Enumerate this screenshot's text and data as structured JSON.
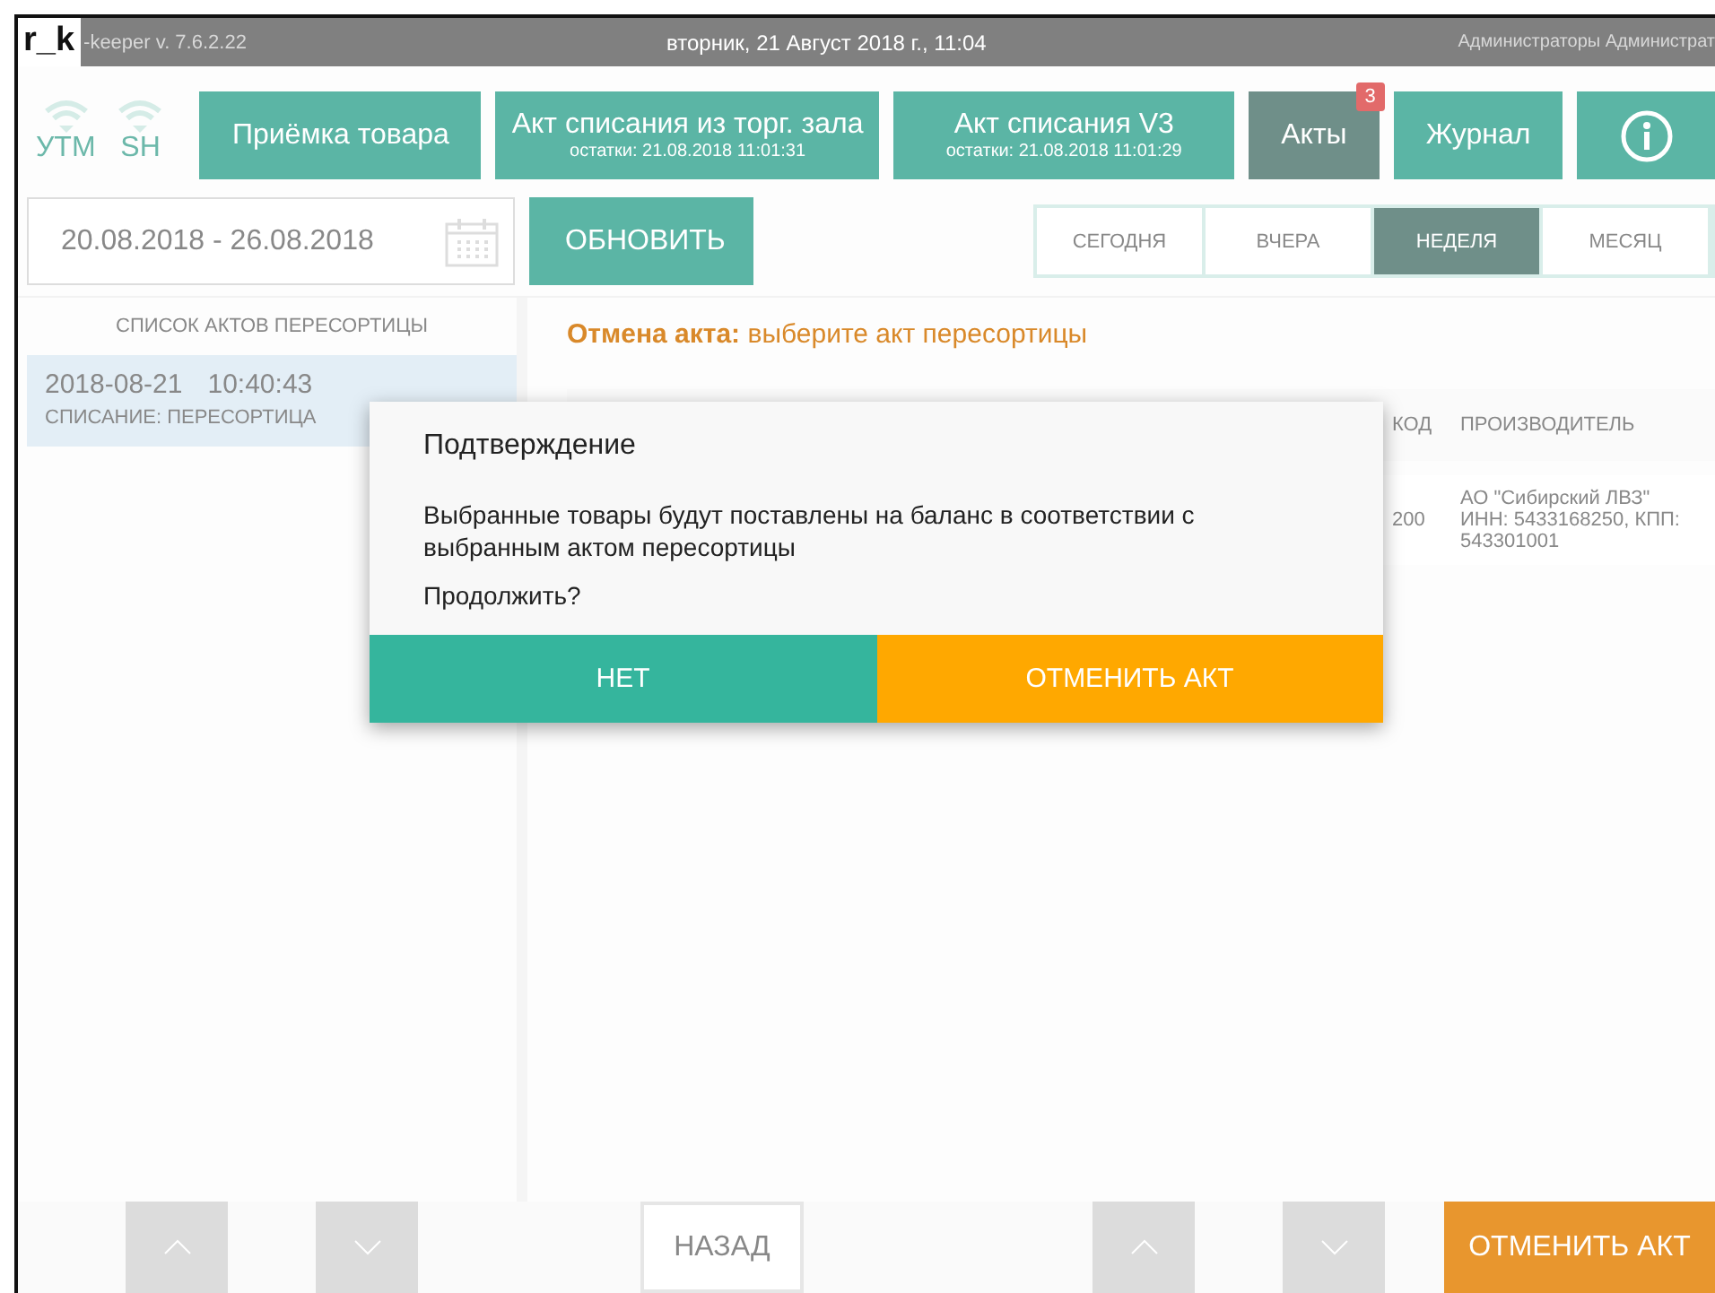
{
  "title_bar": {
    "logo": "r_k",
    "version": "-keeper v. 7.6.2.22",
    "datetime": "вторник, 21 Август 2018 г., 11:04",
    "user": "Администраторы Администрат"
  },
  "status_icons": [
    {
      "label": "УТМ"
    },
    {
      "label": "SH"
    }
  ],
  "nav_buttons": [
    {
      "kind": "plain",
      "label": "Приёмка товара",
      "selected": false
    },
    {
      "kind": "sub",
      "label": "Акт списания из торг. зала",
      "sub": "остатки: 21.08.2018 11:01:31",
      "selected": false
    },
    {
      "kind": "sub",
      "label": "Акт списания V3",
      "sub": "остатки: 21.08.2018 11:01:29",
      "selected": false
    },
    {
      "kind": "plain",
      "label": "Акты",
      "badge": "3",
      "selected": true
    },
    {
      "kind": "plain",
      "label": "Журнал",
      "selected": false
    },
    {
      "kind": "info",
      "selected": false
    }
  ],
  "date_range": {
    "value": "20.08.2018 - 26.08.2018"
  },
  "refresh_button": "ОБНОВИТЬ",
  "period_tabs": [
    {
      "label": "СЕГОДНЯ",
      "selected": false
    },
    {
      "label": "ВЧЕРА",
      "selected": false
    },
    {
      "label": "НЕДЕЛЯ",
      "selected": true
    },
    {
      "label": "МЕСЯЦ",
      "selected": false
    }
  ],
  "acts_list": {
    "title": "СПИСОК АКТОВ ПЕРЕСОРТИЦЫ",
    "items": [
      {
        "date": "2018-08-21",
        "time": "10:40:43",
        "type": "СПИСАНИЕ: ПЕРЕСОРТИЦА",
        "selected": true
      }
    ]
  },
  "detail": {
    "hint": "**Отмена акта:** выберите акт пересортицы",
    "columns": [
      "КОД",
      "ПРОИЗВОДИТЕЛЬ"
    ],
    "rows": [
      [
        "200",
        "АО \"Сибирский ЛВЗ\" ИНН: 5433168250, КПП: 543301001"
      ]
    ]
  },
  "bottom_bar": {
    "back": "НАЗАД",
    "cancel": "ОТМЕНИТЬ АКТ"
  },
  "dialog": {
    "title": "Подтверждение",
    "message": "Выбранные товары будут поставлены на баланс в соответствии с выбранным актом пересортицы",
    "question": "Продолжить?",
    "buttons": [
      {
        "kind": "secondary",
        "label": "НЕТ"
      },
      {
        "kind": "primary",
        "label": "ОТМЕНИТЬ АКТ"
      }
    ]
  }
}
